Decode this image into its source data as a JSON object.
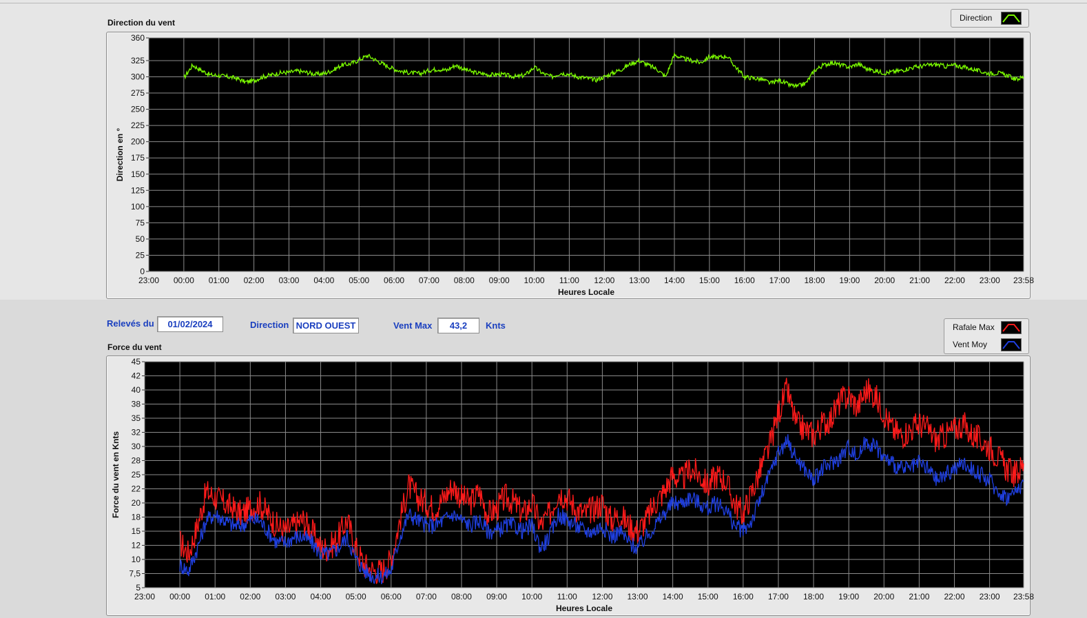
{
  "colors": {
    "plot_bg": "#000000",
    "grid": "#8c8c8c",
    "direction": "#7cfc00",
    "gust": "#ff1a1a",
    "mean": "#1f3fe0",
    "control_text": "#1a3fbf"
  },
  "controls": {
    "date_label": "Relevés du",
    "date_value": "01/02/2024",
    "direction_label": "Direction",
    "direction_value": "NORD OUEST",
    "vmax_label": "Vent Max",
    "vmax_value": "43,2",
    "vmax_unit": "Knts"
  },
  "legends": {
    "direction": {
      "label": "Direction",
      "icon": "line-legend-icon"
    },
    "gust": {
      "label": "Rafale Max",
      "icon": "line-legend-icon"
    },
    "mean": {
      "label": "Vent Moy",
      "icon": "line-legend-icon"
    }
  },
  "chart_data": [
    {
      "type": "line",
      "title": "Direction du vent",
      "xlabel": "Heures Locale",
      "ylabel": "Direction en °",
      "x_tick_labels": [
        "23:00",
        "00:00",
        "01:00",
        "02:00",
        "03:00",
        "04:00",
        "05:00",
        "06:00",
        "07:00",
        "08:00",
        "09:00",
        "10:00",
        "11:00",
        "12:00",
        "13:00",
        "14:00",
        "15:00",
        "16:00",
        "17:00",
        "18:00",
        "19:00",
        "20:00",
        "21:00",
        "22:00",
        "23:00",
        "23:58"
      ],
      "x_range": [
        "23:00",
        "23:58"
      ],
      "y_tick_labels": [
        "0",
        "25",
        "50",
        "75",
        "100",
        "125",
        "150",
        "175",
        "200",
        "225",
        "250",
        "275",
        "300",
        "325",
        "360"
      ],
      "ylim": [
        0,
        360
      ],
      "grid": true,
      "legend_position": "top-right",
      "series": [
        {
          "name": "Direction",
          "x": [
            "00:00",
            "00:15",
            "00:30",
            "00:45",
            "01:00",
            "01:15",
            "01:30",
            "01:45",
            "02:00",
            "02:15",
            "02:30",
            "02:45",
            "03:00",
            "03:15",
            "03:30",
            "03:45",
            "04:00",
            "04:15",
            "04:30",
            "04:45",
            "05:00",
            "05:15",
            "05:30",
            "05:45",
            "06:00",
            "06:15",
            "06:30",
            "06:45",
            "07:00",
            "07:15",
            "07:30",
            "07:45",
            "08:00",
            "08:15",
            "08:30",
            "08:45",
            "09:00",
            "09:15",
            "09:30",
            "09:45",
            "10:00",
            "10:15",
            "10:30",
            "10:45",
            "11:00",
            "11:15",
            "11:30",
            "11:45",
            "12:00",
            "12:15",
            "12:30",
            "12:45",
            "13:00",
            "13:15",
            "13:30",
            "13:45",
            "14:00",
            "14:15",
            "14:30",
            "14:45",
            "15:00",
            "15:15",
            "15:30",
            "15:45",
            "16:00",
            "16:15",
            "16:30",
            "16:45",
            "17:00",
            "17:15",
            "17:30",
            "17:45",
            "18:00",
            "18:15",
            "18:30",
            "18:45",
            "19:00",
            "19:15",
            "19:30",
            "19:45",
            "20:00",
            "20:15",
            "20:30",
            "20:45",
            "21:00",
            "21:15",
            "21:30",
            "21:45",
            "22:00",
            "22:15",
            "22:30",
            "22:45",
            "23:00",
            "23:15",
            "23:30",
            "23:45",
            "23:58"
          ],
          "values": [
            298,
            318,
            310,
            303,
            302,
            300,
            298,
            292,
            294,
            300,
            303,
            306,
            307,
            309,
            307,
            304,
            305,
            310,
            318,
            320,
            326,
            333,
            325,
            318,
            312,
            308,
            306,
            305,
            310,
            312,
            310,
            318,
            312,
            307,
            305,
            303,
            304,
            302,
            300,
            303,
            315,
            305,
            300,
            306,
            304,
            300,
            298,
            295,
            300,
            306,
            312,
            320,
            325,
            318,
            312,
            300,
            334,
            328,
            325,
            322,
            331,
            330,
            332,
            315,
            300,
            298,
            296,
            290,
            295,
            288,
            285,
            290,
            310,
            318,
            322,
            318,
            315,
            320,
            312,
            309,
            306,
            308,
            310,
            314,
            316,
            318,
            319,
            316,
            318,
            315,
            312,
            308,
            305,
            306,
            302,
            296,
            300
          ]
        }
      ]
    },
    {
      "type": "line",
      "title": "Force du vent",
      "xlabel": "Heures Locale",
      "ylabel": "Force du vent en Knts",
      "x_tick_labels": [
        "23:00",
        "00:00",
        "01:00",
        "02:00",
        "03:00",
        "04:00",
        "05:00",
        "06:00",
        "07:00",
        "08:00",
        "09:00",
        "10:00",
        "11:00",
        "12:00",
        "13:00",
        "14:00",
        "15:00",
        "16:00",
        "17:00",
        "18:00",
        "19:00",
        "20:00",
        "21:00",
        "22:00",
        "23:00",
        "23:58"
      ],
      "x_range": [
        "23:00",
        "23:58"
      ],
      "y_tick_labels": [
        "5",
        "7,5",
        "10",
        "12",
        "15",
        "18",
        "20",
        "22",
        "25",
        "28",
        "30",
        "32",
        "35",
        "38",
        "40",
        "42",
        "45"
      ],
      "ylim": [
        5,
        45
      ],
      "grid": true,
      "legend_position": "top-right",
      "series": [
        {
          "name": "Rafale Max",
          "x": [
            "00:00",
            "00:15",
            "00:30",
            "00:45",
            "01:00",
            "01:15",
            "01:30",
            "01:45",
            "02:00",
            "02:15",
            "02:30",
            "02:45",
            "03:00",
            "03:15",
            "03:30",
            "03:45",
            "04:00",
            "04:15",
            "04:30",
            "04:45",
            "05:00",
            "05:15",
            "05:30",
            "05:45",
            "06:00",
            "06:15",
            "06:30",
            "06:45",
            "07:00",
            "07:15",
            "07:30",
            "07:45",
            "08:00",
            "08:15",
            "08:30",
            "08:45",
            "09:00",
            "09:15",
            "09:30",
            "09:45",
            "10:00",
            "10:15",
            "10:30",
            "10:45",
            "11:00",
            "11:15",
            "11:30",
            "11:45",
            "12:00",
            "12:15",
            "12:30",
            "12:45",
            "13:00",
            "13:15",
            "13:30",
            "13:45",
            "14:00",
            "14:15",
            "14:30",
            "14:45",
            "15:00",
            "15:15",
            "15:30",
            "15:45",
            "16:00",
            "16:15",
            "16:30",
            "16:45",
            "17:00",
            "17:15",
            "17:30",
            "17:45",
            "18:00",
            "18:15",
            "18:30",
            "18:45",
            "19:00",
            "19:15",
            "19:30",
            "19:45",
            "20:00",
            "20:15",
            "20:30",
            "20:45",
            "21:00",
            "21:15",
            "21:30",
            "21:45",
            "22:00",
            "22:15",
            "22:30",
            "22:45",
            "23:00",
            "23:15",
            "23:30",
            "23:45",
            "23:58"
          ],
          "values": [
            13,
            11,
            16,
            22,
            21,
            20,
            19,
            18,
            19,
            20,
            18,
            16,
            15,
            16,
            17,
            15,
            12,
            12,
            14,
            17,
            12,
            9,
            8,
            8,
            10,
            17,
            23,
            21,
            20,
            19,
            21,
            23,
            21,
            20,
            22,
            18,
            19,
            21,
            20,
            18,
            20,
            16,
            18,
            22,
            21,
            19,
            18,
            19,
            20,
            17,
            18,
            16,
            15,
            17,
            20,
            22,
            25,
            24,
            26,
            25,
            23,
            25,
            24,
            20,
            18,
            22,
            26,
            30,
            36,
            40,
            34,
            33,
            32,
            34,
            35,
            38,
            39,
            37,
            40,
            39,
            36,
            33,
            32,
            33,
            34,
            33,
            31,
            32,
            33,
            34,
            32,
            31,
            30,
            28,
            26,
            25,
            27
          ]
        },
        {
          "name": "Vent Moy",
          "x": [
            "00:00",
            "00:15",
            "00:30",
            "00:45",
            "01:00",
            "01:15",
            "01:30",
            "01:45",
            "02:00",
            "02:15",
            "02:30",
            "02:45",
            "03:00",
            "03:15",
            "03:30",
            "03:45",
            "04:00",
            "04:15",
            "04:30",
            "04:45",
            "05:00",
            "05:15",
            "05:30",
            "05:45",
            "06:00",
            "06:15",
            "06:30",
            "06:45",
            "07:00",
            "07:15",
            "07:30",
            "07:45",
            "08:00",
            "08:15",
            "08:30",
            "08:45",
            "09:00",
            "09:15",
            "09:30",
            "09:45",
            "10:00",
            "10:15",
            "10:30",
            "10:45",
            "11:00",
            "11:15",
            "11:30",
            "11:45",
            "12:00",
            "12:15",
            "12:30",
            "12:45",
            "13:00",
            "13:15",
            "13:30",
            "13:45",
            "14:00",
            "14:15",
            "14:30",
            "14:45",
            "15:00",
            "15:15",
            "15:30",
            "15:45",
            "16:00",
            "16:15",
            "16:30",
            "16:45",
            "17:00",
            "17:15",
            "17:30",
            "17:45",
            "18:00",
            "18:15",
            "18:30",
            "18:45",
            "19:00",
            "19:15",
            "19:30",
            "19:45",
            "20:00",
            "20:15",
            "20:30",
            "20:45",
            "21:00",
            "21:15",
            "21:30",
            "21:45",
            "22:00",
            "22:15",
            "22:30",
            "22:45",
            "23:00",
            "23:15",
            "23:30",
            "23:45",
            "23:58"
          ],
          "values": [
            9,
            8,
            12,
            17,
            18,
            17,
            16,
            16,
            17,
            17,
            15,
            13,
            13,
            14,
            14,
            13,
            11,
            11,
            12,
            14,
            10,
            8,
            7,
            7,
            8,
            14,
            18,
            17,
            16,
            16,
            17,
            18,
            17,
            16,
            17,
            15,
            15,
            16,
            16,
            15,
            16,
            12,
            14,
            18,
            17,
            16,
            15,
            15,
            16,
            14,
            15,
            13,
            12,
            14,
            16,
            18,
            20,
            20,
            21,
            20,
            19,
            20,
            19,
            16,
            15,
            17,
            21,
            25,
            29,
            31,
            28,
            26,
            24,
            26,
            27,
            28,
            30,
            28,
            31,
            30,
            28,
            27,
            26,
            26,
            27,
            26,
            24,
            25,
            26,
            27,
            26,
            25,
            24,
            22,
            21,
            22,
            24
          ]
        }
      ]
    }
  ]
}
